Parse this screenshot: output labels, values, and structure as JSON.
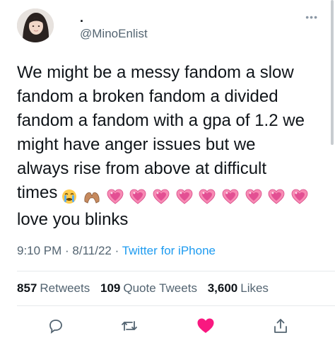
{
  "author": {
    "display_name": ".",
    "handle": "@MinoEnlist",
    "avatar_icon": "profile-photo"
  },
  "more_icon": "ellipsis-icon",
  "tweet": {
    "lines": [
      "We might be a messy fandom a slow",
      "fandom a broken fandom a divided",
      "fandom a fandom with a gpa of 1.2 we",
      "might have anger issues but we",
      "always rise from above at difficult",
      "times",
      "love you blinks"
    ],
    "emojis": [
      "crying-face",
      "heart-hands",
      "sparkling-heart",
      "sparkling-heart",
      "sparkling-heart",
      "sparkling-heart",
      "sparkling-heart",
      "sparkling-heart",
      "sparkling-heart",
      "sparkling-heart",
      "sparkling-heart"
    ]
  },
  "meta": {
    "time": "9:10 PM",
    "sep1": " · ",
    "date": "8/11/22",
    "sep2": " · ",
    "source": "Twitter for iPhone"
  },
  "stats": {
    "retweets_count": "857",
    "retweets_label": "Retweets",
    "quotes_count": "109",
    "quotes_label": "Quote Tweets",
    "likes_count": "3,600",
    "likes_label": "Likes"
  },
  "colors": {
    "accent": "#1d9bf0",
    "like": "#f91880",
    "muted": "#536471"
  }
}
